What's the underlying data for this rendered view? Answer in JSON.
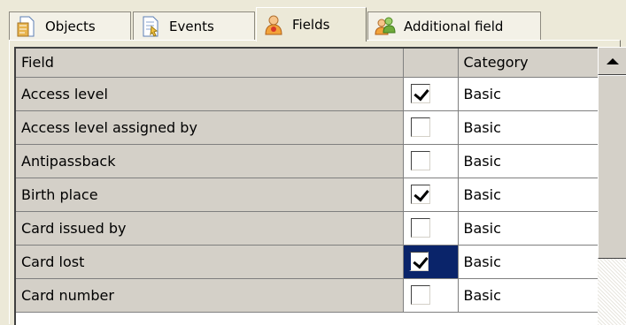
{
  "tabs": [
    {
      "label": "Objects",
      "icon": "objects-icon",
      "active": false
    },
    {
      "label": "Events",
      "icon": "events-icon",
      "active": false
    },
    {
      "label": "Fields",
      "icon": "fields-icon",
      "active": true
    },
    {
      "label": "Additional field",
      "icon": "additional-field-icon",
      "active": false
    }
  ],
  "grid": {
    "columns": [
      "Field",
      "",
      "Category"
    ],
    "rows": [
      {
        "field": "Access level",
        "checked": true,
        "category": "Basic"
      },
      {
        "field": "Access level assigned by",
        "checked": false,
        "category": "Basic"
      },
      {
        "field": "Antipassback",
        "checked": false,
        "category": "Basic"
      },
      {
        "field": "Birth place",
        "checked": true,
        "category": "Basic"
      },
      {
        "field": "Card issued by",
        "checked": false,
        "category": "Basic"
      },
      {
        "field": "Card lost",
        "checked": true,
        "category": "Basic",
        "selected": true
      },
      {
        "field": "Card number",
        "checked": false,
        "category": "Basic"
      }
    ]
  },
  "colors": {
    "selection": "#0a246a",
    "face": "#d4d0c8",
    "window": "#ece9d8"
  }
}
